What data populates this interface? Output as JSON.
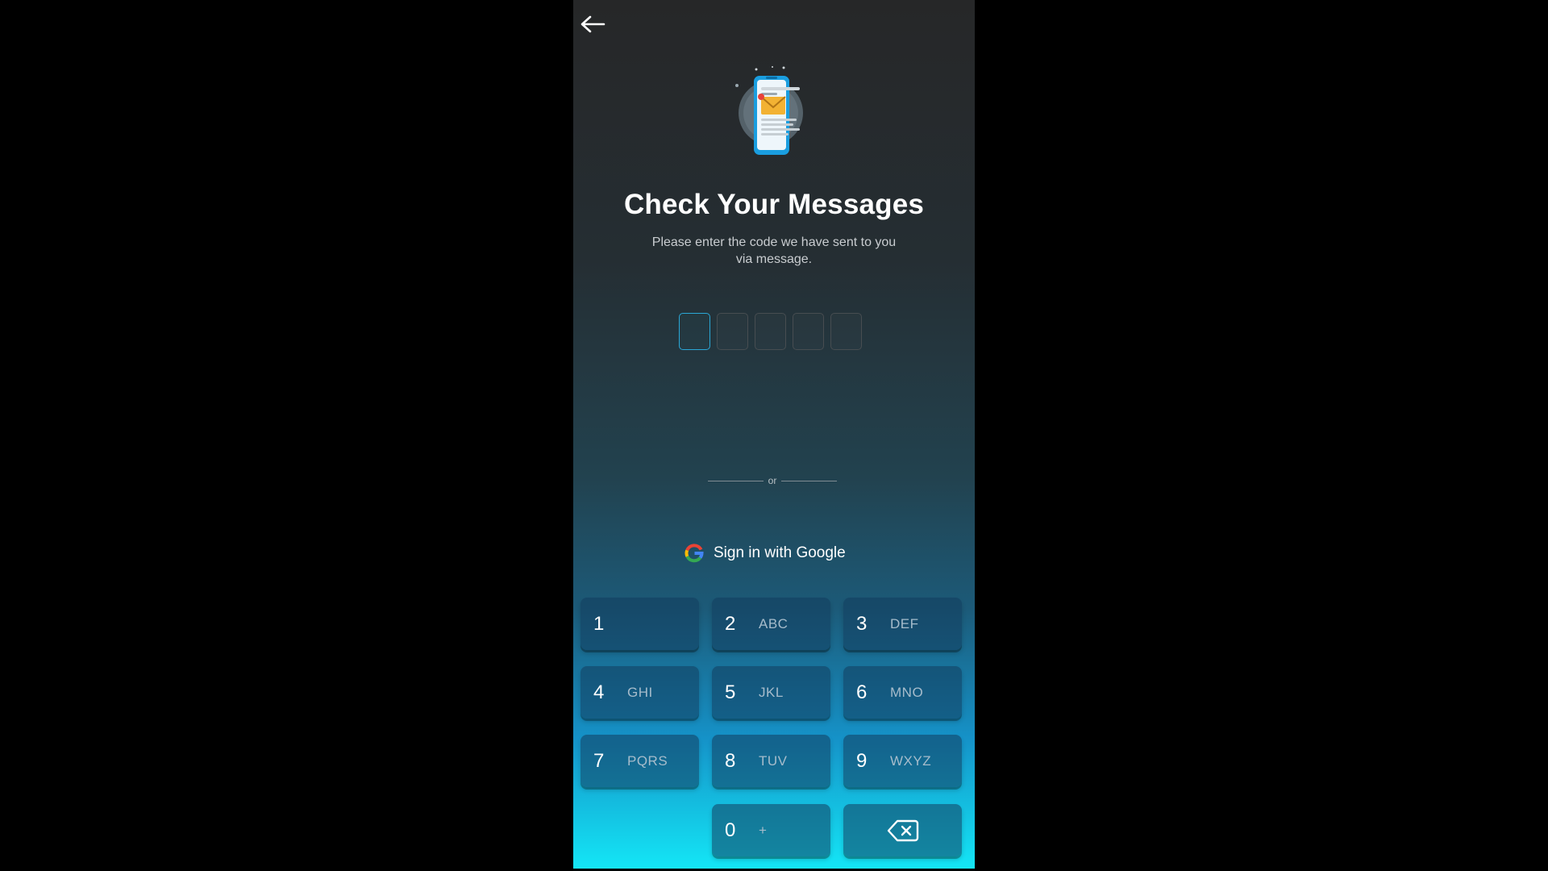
{
  "screen": {
    "title": "Check Your Messages",
    "subtitle_line1": "Please enter the code we have sent to you",
    "subtitle_line2": "via message.",
    "code_length": 5,
    "active_digit": 1
  },
  "divider": {
    "label": "or"
  },
  "google": {
    "label": "Sign in with Google"
  },
  "keypad": {
    "keys": [
      {
        "num": "1",
        "letters": ""
      },
      {
        "num": "2",
        "letters": "ABC"
      },
      {
        "num": "3",
        "letters": "DEF"
      },
      {
        "num": "4",
        "letters": "GHI"
      },
      {
        "num": "5",
        "letters": "JKL"
      },
      {
        "num": "6",
        "letters": "MNO"
      },
      {
        "num": "7",
        "letters": "PQRS"
      },
      {
        "num": "8",
        "letters": "TUV"
      },
      {
        "num": "9",
        "letters": "WXYZ"
      },
      {
        "num": "0",
        "letters": "+"
      }
    ]
  },
  "icons": {
    "back": "arrow-left-icon",
    "hero": "phone-message-illustration",
    "google": "google-g-icon",
    "backspace": "backspace-icon"
  },
  "colors": {
    "active_border": "#2aa7d6",
    "gradient_bottom": "#14e6f6"
  }
}
